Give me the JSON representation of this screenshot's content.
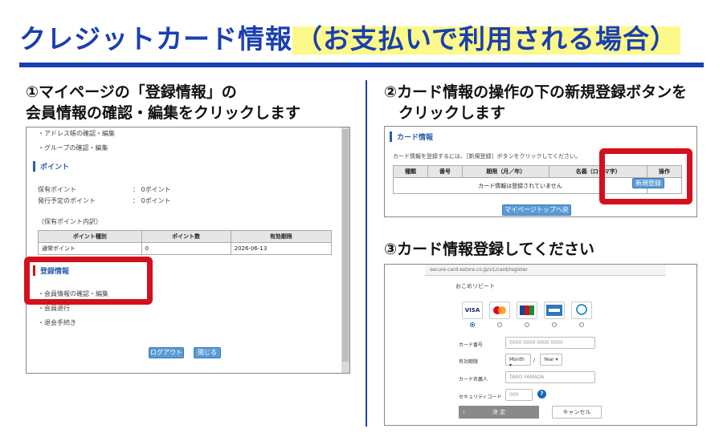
{
  "header": {
    "title_main": "クレジットカード情報",
    "title_highlight": "（お支払いで利用される場合）"
  },
  "steps": {
    "step1_line1": "①マイページの「登録情報」の",
    "step1_line2": "会員情報の確認・編集をクリックします",
    "step2_line1": "②カード情報の操作の下の新規登録ボタンを",
    "step2_line2": "クリックします",
    "step3": "③カード情報登録してください"
  },
  "shot1": {
    "links_top": [
      "・アドレス帳の確認・編集",
      "・グループの確認・編集"
    ],
    "points_title": "ポイント",
    "holding_label": "保有ポイント",
    "holding_value": "：  0ポイント",
    "pending_label": "発行予定のポイント",
    "pending_value": "：  0ポイント",
    "breakdown_label": "（保有ポイント内訳）",
    "table_headers": [
      "ポイント種別",
      "ポイント数",
      "有効期限"
    ],
    "table_row": [
      "通常ポイント",
      "0",
      "2026-06-13"
    ],
    "reg_title": "登録情報",
    "reg_links": [
      "・会員情報の確認・編集",
      "・会員退行",
      "・退会手続き"
    ],
    "logout_label": "ログアウト",
    "close_label": "閉じる"
  },
  "shot2": {
    "section_title": "カード情報",
    "instruction": "カード情報を登録するには、［新規登録］ボタンをクリックしてください。",
    "headers": [
      "種類",
      "番号",
      "期限（月／年）",
      "名義（ローマ字）",
      "操作"
    ],
    "empty_msg": "カード情報は登録されていません",
    "new_button": "新規登録",
    "back_button": "マイページトップへ戻る"
  },
  "shot3": {
    "url": "secure-card.estore.co.jp/v1/card/register",
    "site_title": "おこめリビート",
    "brands": [
      "VISA",
      "MC",
      "JCB",
      "AMEX",
      "Diners"
    ],
    "card_no_label": "カード番号",
    "card_no_placeholder": "0000 0000 0000 0000",
    "expiry_label": "有効期限",
    "month_placeholder": "Month ▾",
    "slash": "/",
    "year_placeholder": "Year ▾",
    "holder_label": "カード名義人",
    "holder_placeholder": "TARO YAMADA",
    "cvc_label": "セキュリティコード",
    "cvc_placeholder": "000",
    "help_mark": "?",
    "submit_label": "決 定",
    "cancel_label": "キャンセル"
  }
}
